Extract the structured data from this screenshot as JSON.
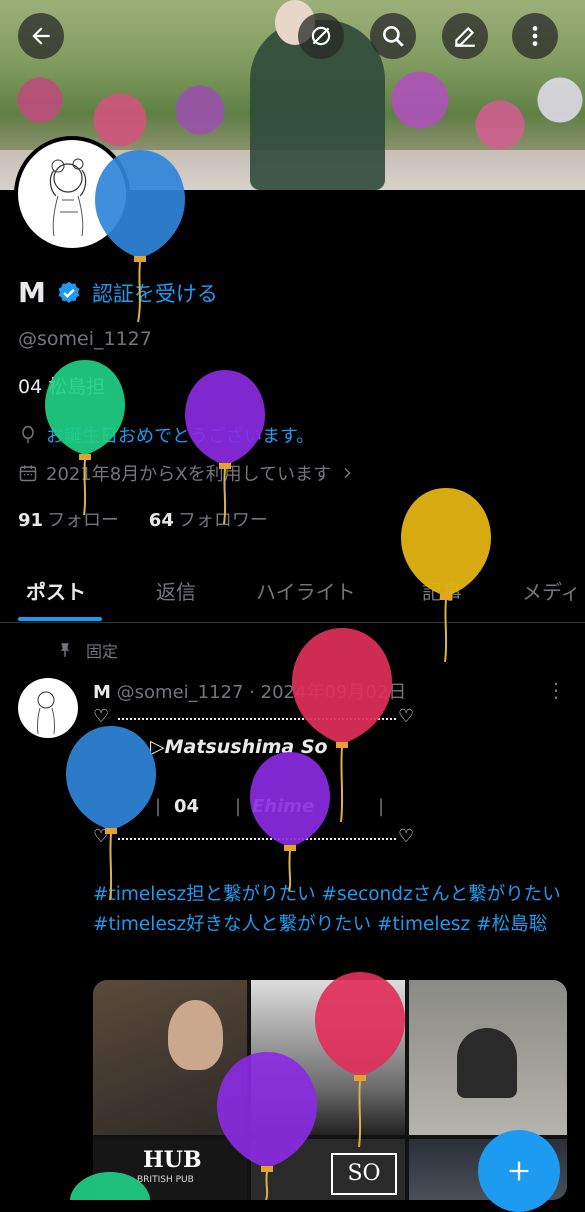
{
  "nav": {
    "back_icon": "arrow-left-icon",
    "grok_icon": "grok-icon",
    "search_icon": "search-icon",
    "edit_icon": "pencil-icon",
    "more_icon": "more-vertical-icon"
  },
  "profile": {
    "display_name": "M",
    "verify_label": "認証を受ける",
    "handle": "@somei_1127",
    "bio": "04  松島担",
    "birthday_text": "お誕生日おめでとうございます。",
    "joined_text": "2021年8月からXを利用しています",
    "following_count": "91",
    "following_label": "フォロー",
    "followers_count": "64",
    "followers_label": "フォロワー"
  },
  "tabs": [
    "ポスト",
    "返信",
    "ハイライト",
    "記事",
    "メディ"
  ],
  "post": {
    "pinned_label": "固定",
    "author": "M",
    "handle_date": "@somei_1127 · 2024年09月02日",
    "deco_title": "▷Matsushima So",
    "deco_num": "04",
    "deco_place": "Ehime",
    "hashtags": "#timelesz担と繋がりたい #secondzさんと繋がりたい #timelesz好きな人と繋がりたい #timelesz #松島聡",
    "media_hub_label": "HUB",
    "media_hub_sub": "BRITISH PUB",
    "media_so_label": "SO"
  },
  "colors": {
    "accent": "#1d9bf0",
    "balloon_blue": "#2f86d9",
    "balloon_green": "#1fcf86",
    "balloon_purple": "#8a2be2",
    "balloon_yellow": "#e3b312",
    "balloon_red": "#e0305a"
  }
}
